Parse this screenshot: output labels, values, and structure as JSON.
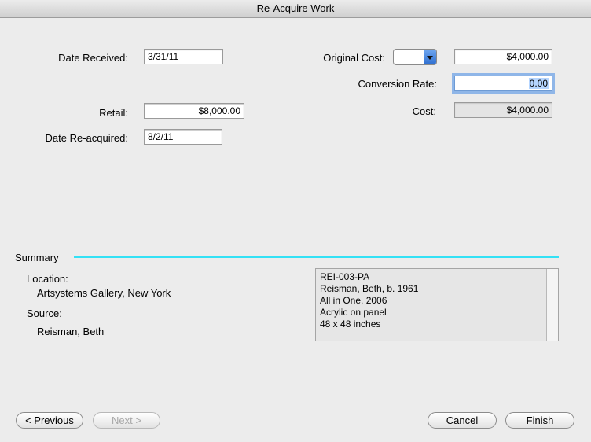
{
  "window": {
    "title": "Re-Acquire Work"
  },
  "form": {
    "date_received": {
      "label": "Date Received:",
      "value": "3/31/11"
    },
    "retail": {
      "label": "Retail:",
      "value": "$8,000.00"
    },
    "date_reacquired": {
      "label": "Date Re-acquired:",
      "value": "8/2/11"
    },
    "original_cost": {
      "label": "Original Cost:",
      "currency": "",
      "value": "$4,000.00"
    },
    "conversion_rate": {
      "label": "Conversion Rate:",
      "value": "0.00"
    },
    "cost": {
      "label": "Cost:",
      "value": "$4,000.00"
    }
  },
  "summary": {
    "heading": "Summary",
    "location_label": "Location:",
    "location_value": "Artsystems Gallery, New York",
    "source_label": "Source:",
    "source_value": "Reisman, Beth",
    "details": [
      "REI-003-PA",
      "Reisman, Beth, b. 1961",
      "All in One, 2006",
      "Acrylic on panel",
      "48 x 48 inches"
    ]
  },
  "buttons": {
    "previous": "< Previous",
    "next": "Next >",
    "cancel": "Cancel",
    "finish": "Finish"
  },
  "colors": {
    "accent_line": "#33e1f5",
    "focus_ring": "#8fb6e8"
  }
}
